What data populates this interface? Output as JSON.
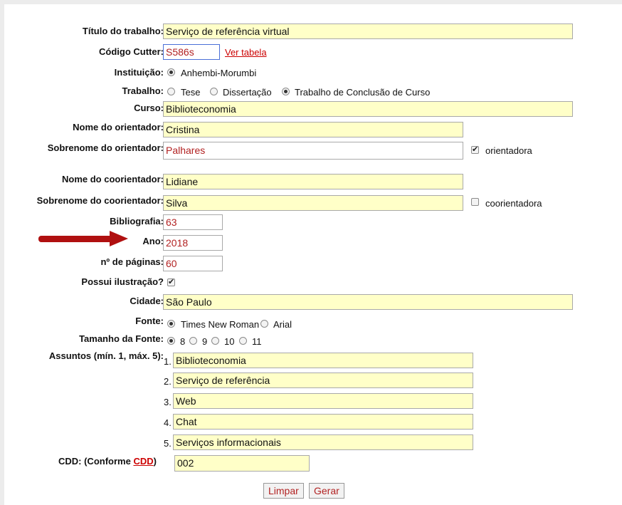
{
  "form": {
    "titulo_label": "Título do trabalho:",
    "titulo_value": "Serviço de referência virtual",
    "cutter_label": "Código Cutter:",
    "cutter_value": "S586s",
    "ver_tabela": "Ver tabela",
    "instituicao_label": "Instituição:",
    "instituicao_option": "Anhembi-Morumbi",
    "trabalho_label": "Trabalho:",
    "trabalho_options": [
      "Tese",
      "Dissertação",
      "Trabalho de Conclusão de Curso"
    ],
    "trabalho_selected": "Trabalho de Conclusão de Curso",
    "curso_label": "Curso:",
    "curso_value": "Biblioteconomia",
    "nome_orientador_label": "Nome do orientador:",
    "nome_orientador_value": "Cristina",
    "sobrenome_orientador_label": "Sobrenome do orientador:",
    "sobrenome_orientador_value": "Palhares",
    "orientadora_label": "orientadora",
    "orientadora_checked": true,
    "nome_coorientador_label": "Nome do coorientador:",
    "nome_coorientador_value": "Lidiane",
    "sobrenome_coorientador_label": "Sobrenome do coorientador:",
    "sobrenome_coorientador_value": "Silva",
    "coorientadora_label": "coorientadora",
    "coorientadora_checked": false,
    "bibliografia_label": "Bibliografia:",
    "bibliografia_value": "63",
    "ano_label": "Ano:",
    "ano_value": "2018",
    "paginas_label": "nº de páginas:",
    "paginas_value": "60",
    "ilustracao_label": "Possui ilustração?",
    "ilustracao_checked": true,
    "cidade_label": "Cidade:",
    "cidade_value": "São Paulo",
    "fonte_label": "Fonte:",
    "fonte_options": [
      "Times New Roman",
      "Arial"
    ],
    "fonte_selected": "Times New Roman",
    "tamanho_label": "Tamanho da Fonte:",
    "tamanho_options": [
      "8",
      "9",
      "10",
      "11"
    ],
    "tamanho_selected": "8",
    "assuntos_label": "Assuntos (mín. 1, máx. 5):",
    "assuntos": [
      {
        "num": "1.",
        "value": "Biblioteconomia"
      },
      {
        "num": "2.",
        "value": "Serviço de referência"
      },
      {
        "num": "3.",
        "value": "Web"
      },
      {
        "num": "4.",
        "value": "Chat"
      },
      {
        "num": "5.",
        "value": "Serviços informacionais"
      }
    ],
    "cdd_label": "CDD: (Conforme ",
    "cdd_link": "CDD",
    "cdd_label_end": ")",
    "cdd_value": "002",
    "limpar_button": "Limpar",
    "gerar_button": "Gerar"
  },
  "colors": {
    "field_yellow": "#ffffc8",
    "value_red": "#b22222",
    "link_red": "#cc0000",
    "arrow_red": "#b01010"
  },
  "annotation": {
    "arrow_icon": "red-arrow-right-icon"
  }
}
